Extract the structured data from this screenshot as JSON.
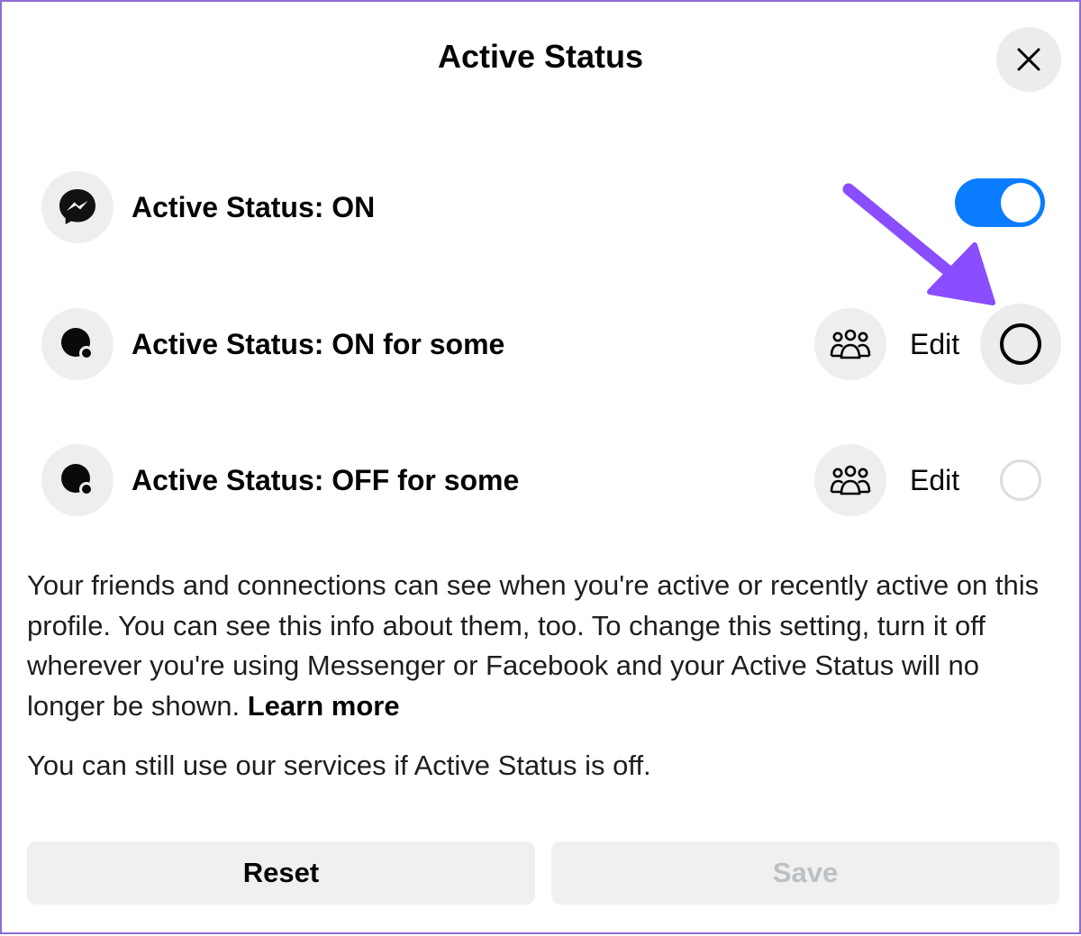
{
  "dialog": {
    "title": "Active Status",
    "close_icon": "close-icon"
  },
  "options": [
    {
      "label": "Active Status: ON",
      "icon": "messenger-icon",
      "control": "toggle",
      "toggle_on": true,
      "accent": "#0a7cff"
    },
    {
      "label": "Active Status: ON for some",
      "icon": "status-dot-icon",
      "people_icon": "people-icon",
      "edit_label": "Edit",
      "selected": false
    },
    {
      "label": "Active Status: OFF for some",
      "icon": "status-dot-icon",
      "people_icon": "people-icon",
      "edit_label": "Edit",
      "selected": false
    }
  ],
  "description": {
    "text": "Your friends and connections can see when you're active or recently active on this profile. You can see this info about them, too. To change this setting, turn it off wherever you're using Messenger or Facebook and your Active Status will no longer be shown.",
    "link": "Learn more"
  },
  "note": "You can still use our services if Active Status is off.",
  "buttons": {
    "reset": "Reset",
    "save": "Save"
  },
  "annotation": {
    "color": "#8a4dff",
    "icon": "arrow-annotation"
  }
}
